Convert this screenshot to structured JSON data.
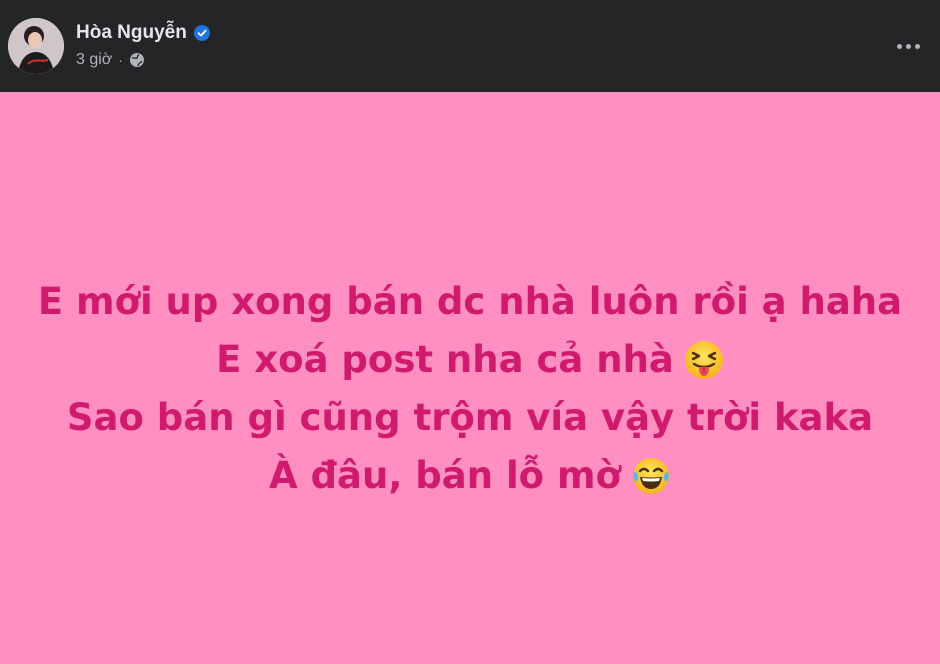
{
  "post": {
    "author_name": "Hòa Nguyễn",
    "verified": true,
    "time": "3 giờ",
    "separator": "·",
    "audience_icon": "globe-icon",
    "more_icon": "more-options-icon",
    "background_color": "#ff8fc0",
    "text_color": "#cf1a6e",
    "lines": [
      {
        "text": "E mới up xong bán dc nhà luôn rồi ạ haha",
        "emoji": ""
      },
      {
        "text": "E xoá post nha cả nhà",
        "emoji": "squinting-face-with-tongue-emoji"
      },
      {
        "text": "Sao bán gì cũng trộm vía vậy trời kaka",
        "emoji": ""
      },
      {
        "text": "À đâu, bán lỗ mờ",
        "emoji": "face-with-tears-of-joy-emoji"
      }
    ]
  }
}
